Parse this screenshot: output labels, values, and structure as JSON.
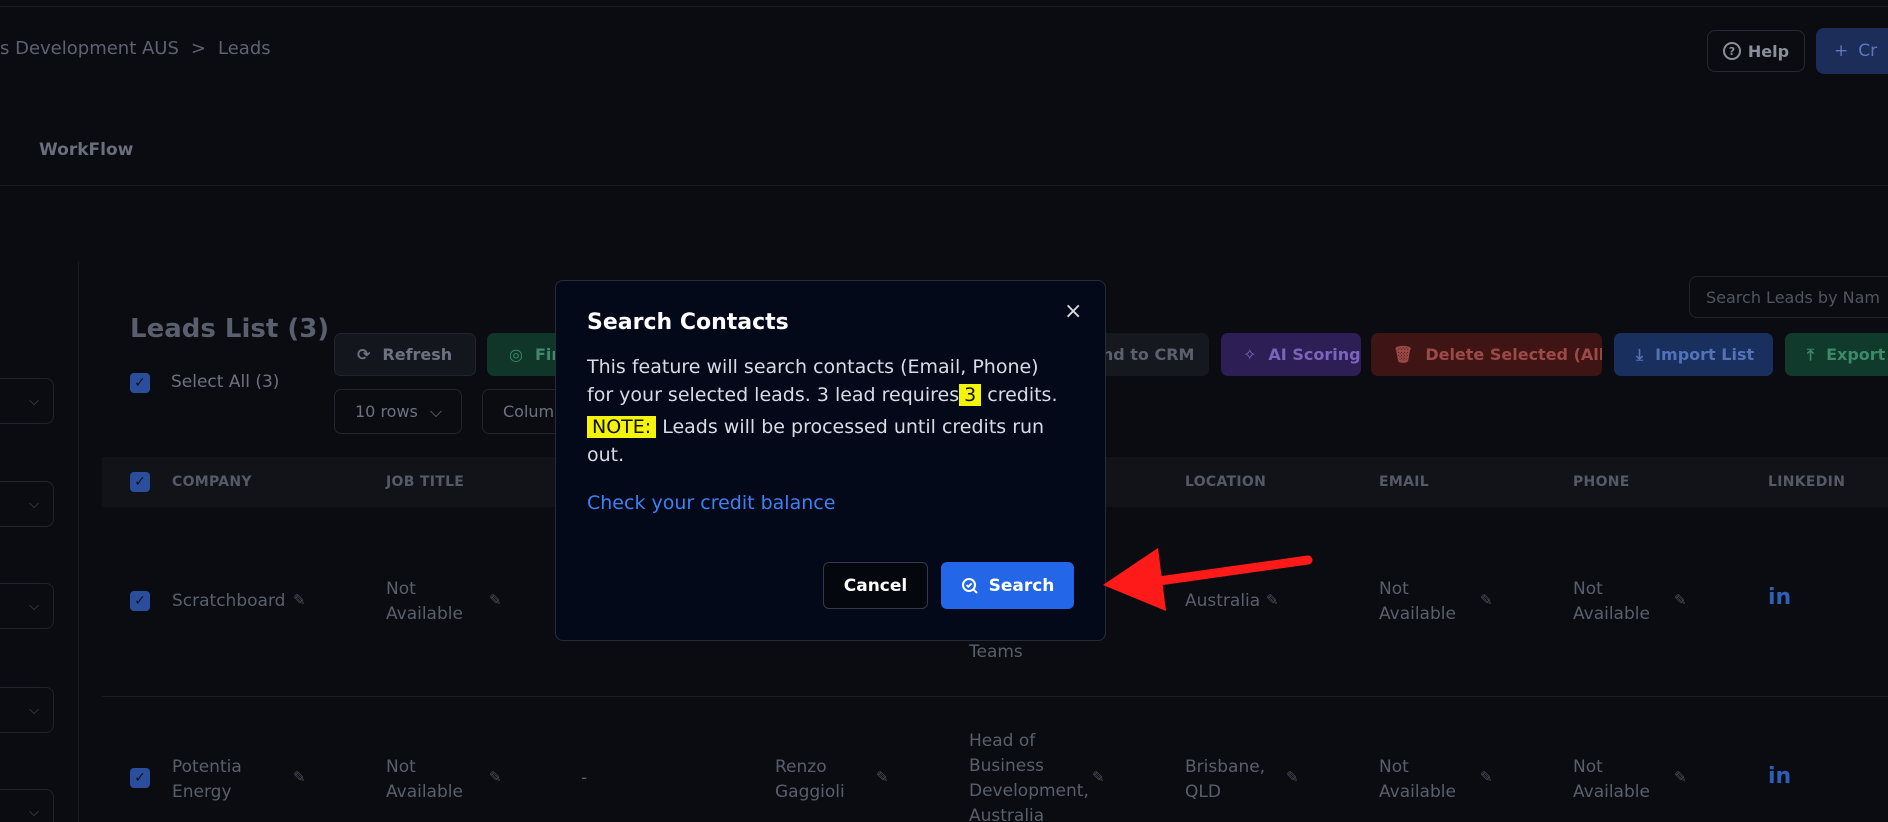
{
  "header": {
    "breadcrumb_parent": "s Development AUS",
    "breadcrumb_separator": ">",
    "breadcrumb_current": "Leads",
    "help_label": "Help",
    "create_label": "Cr"
  },
  "tabs": {
    "workflow": "WorkFlow"
  },
  "leads": {
    "title": "Leads List (3)",
    "select_all": "Select All (3)",
    "search_placeholder": "Search Leads by Nam"
  },
  "toolbar": {
    "refresh": "Refresh",
    "find": "Fin",
    "send_crm": "end to CRM",
    "ai_scoring": "AI Scoring",
    "delete_selected": "Delete Selected  (All)",
    "import_list": "Import List",
    "export": "Export",
    "rows": "10 rows",
    "columns": "Colum"
  },
  "table": {
    "headers": [
      "COMPANY",
      "JOB TITLE",
      "LOCATION",
      "EMAIL",
      "PHONE",
      "LINKEDIN"
    ],
    "rows": [
      {
        "company": "Scratchboard",
        "job_title": "Not Available",
        "title_fragment": "Teams",
        "location": "Australia",
        "email": "Not Available",
        "phone": "Not Available"
      },
      {
        "company": "Potentia Energy",
        "job_title": "Not Available",
        "dash": "-",
        "name": "Renzo Gaggioli",
        "title": "Head of Business Development, Australia",
        "location": "Brisbane, QLD",
        "email": "Not Available",
        "phone": "Not Available"
      }
    ],
    "linkedin_glyph": "in"
  },
  "modal": {
    "title": "Search Contacts",
    "close": "×",
    "body_line1": "This feature will search contacts (Email, Phone)",
    "body_line2_pre": "for your selected leads. 3 lead requires",
    "credits_value": "3",
    "body_line2_post": " credits.",
    "note_label": "NOTE:",
    "note_text": " Leads will be processed until credits run out.",
    "link": "Check your credit balance",
    "cancel": "Cancel",
    "search": "Search"
  },
  "colors": {
    "modal_bg": "#030918",
    "primary": "#2366e8",
    "highlight": "#f4f40a",
    "link": "#3b82f6",
    "annotation_arrow": "#ff1a1a"
  },
  "icons": [
    "help-icon",
    "plus-icon",
    "refresh-icon",
    "ai-icon",
    "trash-icon",
    "import-icon",
    "export-icon",
    "chevron-down-icon",
    "pencil-icon",
    "linkedin-icon",
    "close-icon",
    "search-icon",
    "arrow-annotation"
  ]
}
